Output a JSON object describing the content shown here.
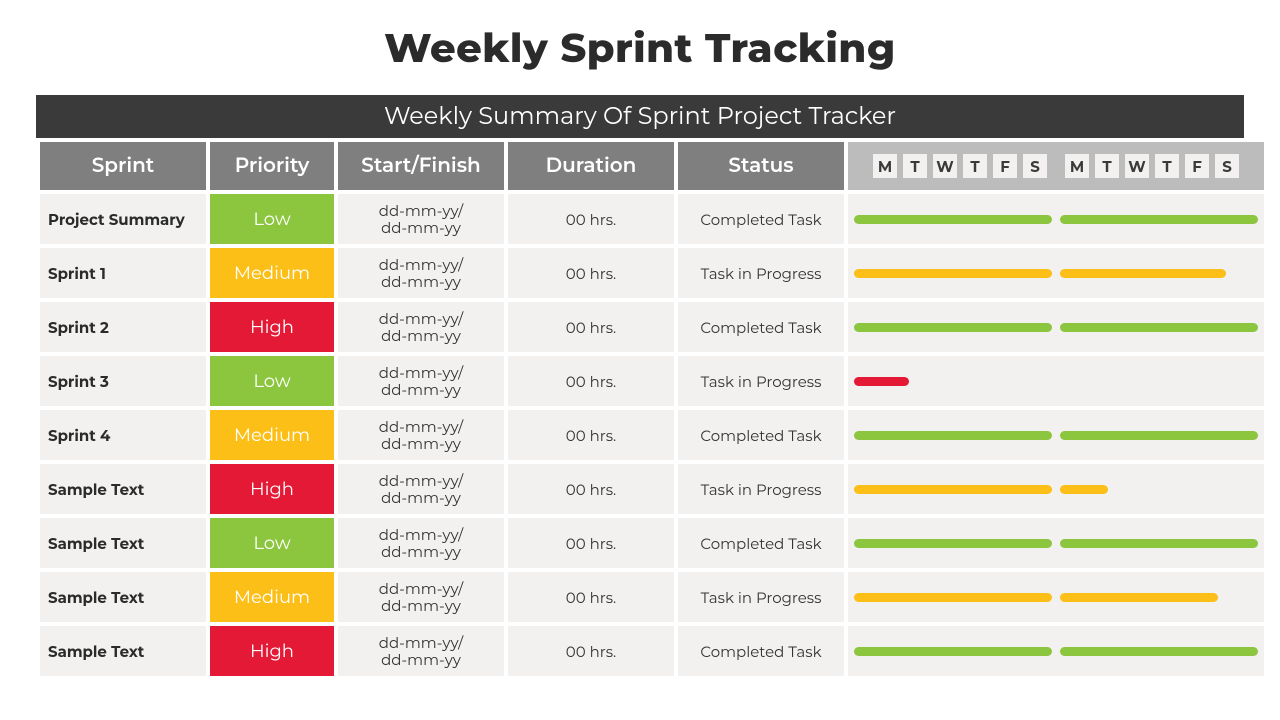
{
  "title": "Weekly Sprint Tracking",
  "banner": "Weekly Summary Of Sprint Project Tracker",
  "columns": {
    "sprint": "Sprint",
    "priority": "Priority",
    "dates": "Start/Finish",
    "duration": "Duration",
    "status": "Status"
  },
  "day_labels": [
    "M",
    "T",
    "W",
    "T",
    "F",
    "S"
  ],
  "priority_labels": {
    "low": "Low",
    "medium": "Medium",
    "high": "High"
  },
  "rows": [
    {
      "name": "Project Summary",
      "priority": "low",
      "dates": "dd-mm-yy/\ndd-mm-yy",
      "duration": "00 hrs.",
      "status": "Completed Task",
      "bar_color": "green",
      "bar_span": [
        0,
        100
      ]
    },
    {
      "name": "Sprint 1",
      "priority": "medium",
      "dates": "dd-mm-yy/\ndd-mm-yy",
      "duration": "00 hrs.",
      "status": "Task in Progress",
      "bar_color": "yellow",
      "bar_span": [
        0,
        92
      ]
    },
    {
      "name": "Sprint 2",
      "priority": "high",
      "dates": "dd-mm-yy/\ndd-mm-yy",
      "duration": "00 hrs.",
      "status": "Completed Task",
      "bar_color": "green",
      "bar_span": [
        0,
        100
      ]
    },
    {
      "name": "Sprint 3",
      "priority": "low",
      "dates": "dd-mm-yy/\ndd-mm-yy",
      "duration": "00 hrs.",
      "status": "Task in Progress",
      "bar_color": "red",
      "bar_span": [
        0,
        14
      ]
    },
    {
      "name": "Sprint 4",
      "priority": "medium",
      "dates": "dd-mm-yy/\ndd-mm-yy",
      "duration": "00 hrs.",
      "status": "Completed Task",
      "bar_color": "green",
      "bar_span": [
        0,
        100
      ]
    },
    {
      "name": "Sample Text",
      "priority": "high",
      "dates": "dd-mm-yy/\ndd-mm-yy",
      "duration": "00 hrs.",
      "status": "Task in Progress",
      "bar_color": "yellow",
      "bar_span": [
        0,
        62
      ]
    },
    {
      "name": "Sample Text",
      "priority": "low",
      "dates": "dd-mm-yy/\ndd-mm-yy",
      "duration": "00 hrs.",
      "status": "Completed Task",
      "bar_color": "green",
      "bar_span": [
        0,
        100
      ]
    },
    {
      "name": "Sample Text",
      "priority": "medium",
      "dates": "dd-mm-yy/\ndd-mm-yy",
      "duration": "00 hrs.",
      "status": "Task in Progress",
      "bar_color": "yellow",
      "bar_span": [
        0,
        90
      ]
    },
    {
      "name": "Sample Text",
      "priority": "high",
      "dates": "dd-mm-yy/\ndd-mm-yy",
      "duration": "00 hrs.",
      "status": "Completed Task",
      "bar_color": "green",
      "bar_span": [
        0,
        100
      ]
    }
  ]
}
